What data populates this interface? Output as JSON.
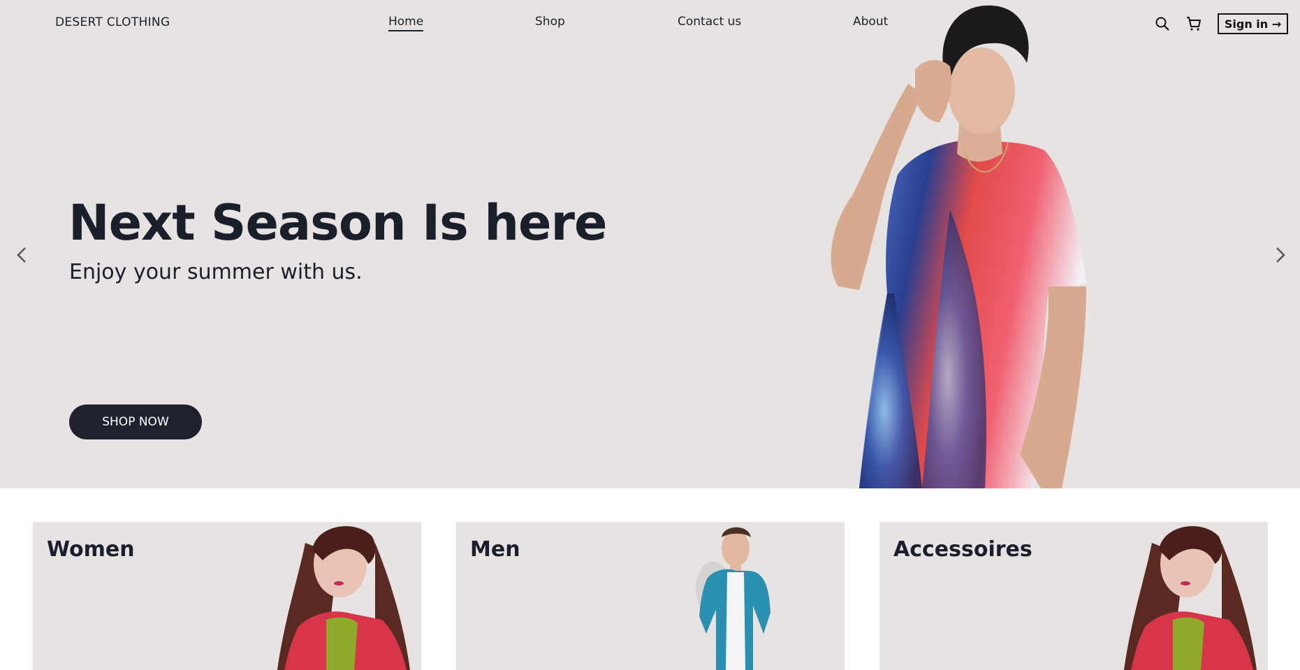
{
  "brand": {
    "name": "DESERT CLOTHING"
  },
  "nav": {
    "items": [
      {
        "label": "Home",
        "active": true
      },
      {
        "label": "Shop",
        "active": false
      },
      {
        "label": "Contact us",
        "active": false
      },
      {
        "label": "About",
        "active": false
      }
    ]
  },
  "header_actions": {
    "search_icon": "search-icon",
    "cart_icon": "cart-icon",
    "signin_label": "Sign in →"
  },
  "hero": {
    "title": "Next Season Is here",
    "subtitle": "Enjoy your summer with us.",
    "cta_label": "SHOP NOW",
    "prev_icon": "chevron-left-icon",
    "next_icon": "chevron-right-icon"
  },
  "categories": [
    {
      "title": "Women"
    },
    {
      "title": "Men"
    },
    {
      "title": "Accessoires"
    }
  ],
  "colors": {
    "hero_bg": "#e7e3e2",
    "text_dark": "#1b1f2b",
    "button_dark": "#20212e",
    "page_bg": "#ffffff"
  }
}
